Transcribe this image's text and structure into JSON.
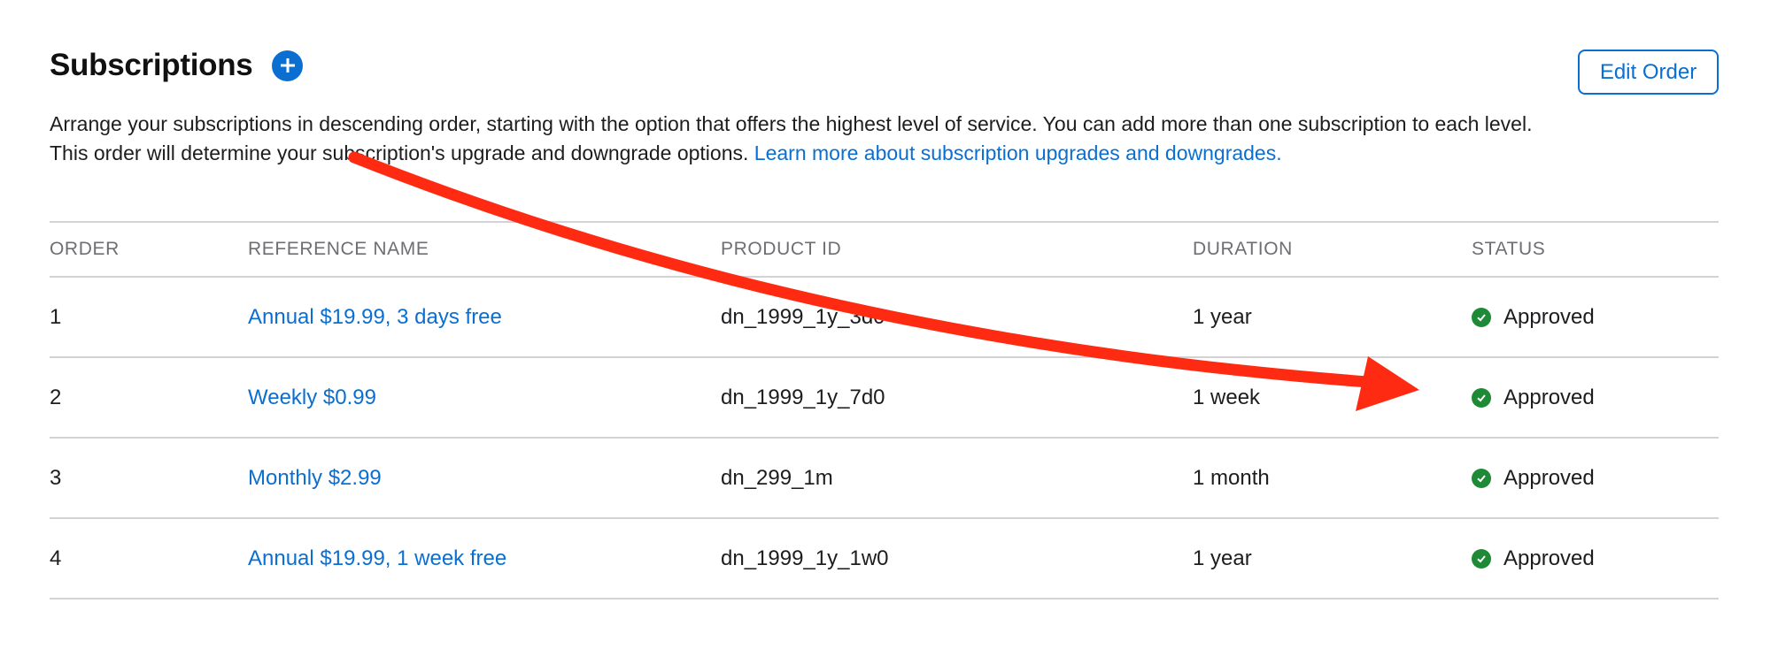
{
  "header": {
    "title": "Subscriptions",
    "edit_order_label": "Edit Order"
  },
  "description": {
    "text": "Arrange your subscriptions in descending order, starting with the option that offers the highest level of service. You can add more than one subscription to each level. This order will determine your subscription's upgrade and downgrade options.",
    "link_text": "Learn more about subscription upgrades and downgrades."
  },
  "table": {
    "columns": [
      "ORDER",
      "REFERENCE NAME",
      "PRODUCT ID",
      "DURATION",
      "STATUS"
    ],
    "rows": [
      {
        "order": "1",
        "name": "Annual $19.99, 3 days free",
        "product_id": "dn_1999_1y_3d0",
        "duration": "1 year",
        "status": "Approved"
      },
      {
        "order": "2",
        "name": "Weekly $0.99",
        "product_id": "dn_1999_1y_7d0",
        "duration": "1 week",
        "status": "Approved"
      },
      {
        "order": "3",
        "name": "Monthly $2.99",
        "product_id": "dn_299_1m",
        "duration": "1 month",
        "status": "Approved"
      },
      {
        "order": "4",
        "name": "Annual $19.99, 1 week free",
        "product_id": "dn_1999_1y_1w0",
        "duration": "1 year",
        "status": "Approved"
      }
    ]
  },
  "colors": {
    "accent": "#0a6fd1",
    "status_approved": "#1e8a36",
    "annotation_arrow": "#ff2a12"
  },
  "icons": {
    "add": "plus-circle-icon",
    "status": "check-circle-icon"
  }
}
